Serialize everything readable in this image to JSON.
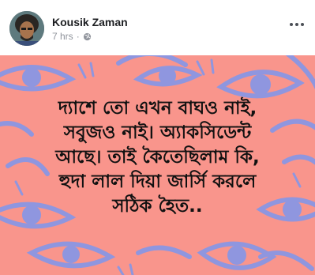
{
  "post": {
    "author": "Kousik Zaman",
    "time": "7 hrs",
    "privacy_icon": "globe-icon",
    "more_icon": "more-options-icon"
  },
  "image": {
    "background_color": "#f9958c",
    "pattern_color": "#8f96df",
    "lines": [
      "দ্যাশে তো এখন বাঘও নাই,",
      "সবুজও নাই। অ্যাকসিডেন্ট",
      "আছে। তাই কৈতেছিলাম কি,",
      "হুদা লাল দিয়া জার্সি করলে",
      "সঠিক হৈত.."
    ]
  }
}
